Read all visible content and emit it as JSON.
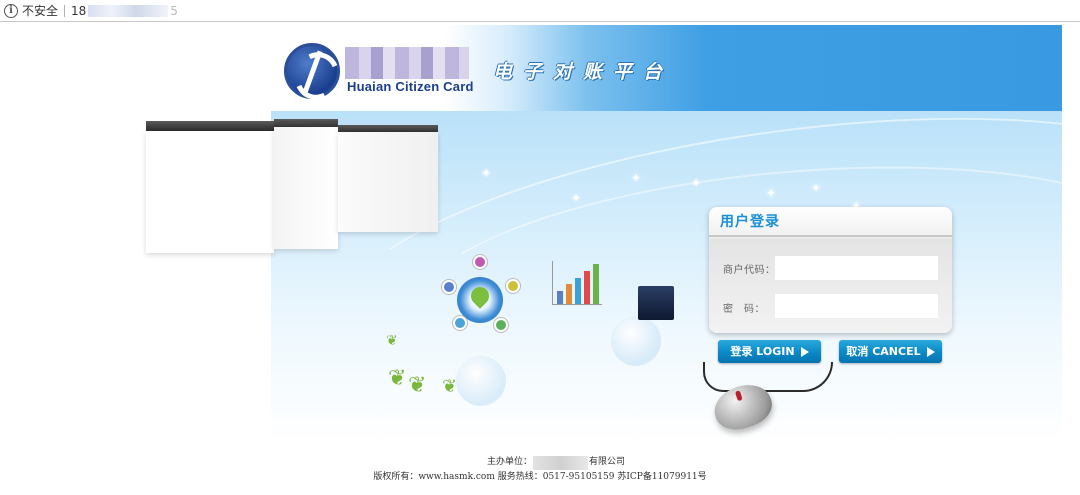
{
  "browser": {
    "security_text": "不安全",
    "url_prefix": "18",
    "url_suffix": "5"
  },
  "header": {
    "logo_en": "Huaian Citizen Card",
    "title": "电子对账平台"
  },
  "login": {
    "title": "用户登录",
    "merchant_label": "商户代码：",
    "merchant_value": "",
    "password_label": "密　码：",
    "password_value": "",
    "login_button": "登录 LOGIN",
    "cancel_button": "取消 CANCEL"
  },
  "footer": {
    "host_label": "主办单位：",
    "host_suffix": "有限公司",
    "copyright": "版权所有：www.hasmk.com 服务热线：0517-95105159 苏ICP备11079911号"
  },
  "colors": {
    "accent": "#1a8fd6",
    "button": "#0b88c6",
    "banner": "#3f9fe4"
  },
  "chart_bars": [
    {
      "color": "#5b7fc4",
      "level": 0.3
    },
    {
      "color": "#e08a3a",
      "level": 0.45
    },
    {
      "color": "#3aa0d8",
      "level": 0.6
    },
    {
      "color": "#e04a4a",
      "level": 0.75
    },
    {
      "color": "#6ab34a",
      "level": 0.9
    }
  ]
}
